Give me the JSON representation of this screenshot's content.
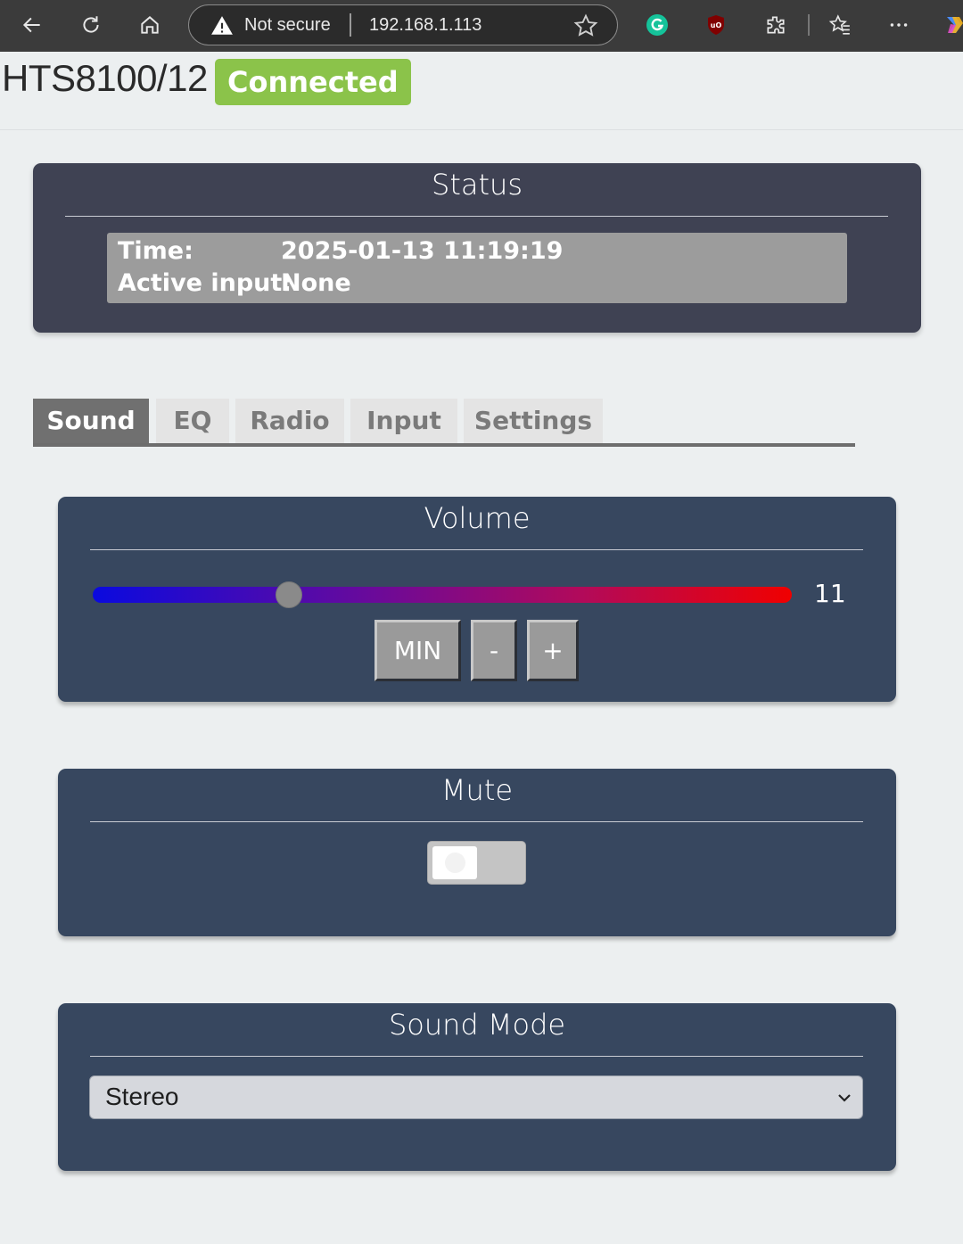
{
  "browser": {
    "security_label": "Not secure",
    "url": "192.168.1.113",
    "icons": [
      "back-arrow-icon",
      "refresh-icon",
      "home-icon",
      "warning-icon",
      "star-icon",
      "grammarly-icon",
      "ublock-icon",
      "extensions-icon",
      "favorites-icon",
      "more-icon",
      "copilot-icon"
    ]
  },
  "header": {
    "device_name": "HTS8100/12",
    "connection_status": "Connected",
    "connection_color": "#8bc34a"
  },
  "status": {
    "title": "Status",
    "time_label": "Time:",
    "time_value": "2025-01-13 11:19:19",
    "input_label": "Active input:",
    "input_value": "None"
  },
  "tabs": [
    {
      "label": "Sound",
      "active": true
    },
    {
      "label": "EQ",
      "active": false
    },
    {
      "label": "Radio",
      "active": false
    },
    {
      "label": "Input",
      "active": false
    },
    {
      "label": "Settings",
      "active": false
    }
  ],
  "volume": {
    "title": "Volume",
    "value": "11",
    "level_fraction": 0.28,
    "min_label": "MIN",
    "minus_label": "-",
    "plus_label": "+"
  },
  "mute": {
    "title": "Mute",
    "enabled": false
  },
  "sound_mode": {
    "title": "Sound Mode",
    "selected": "Stereo"
  }
}
